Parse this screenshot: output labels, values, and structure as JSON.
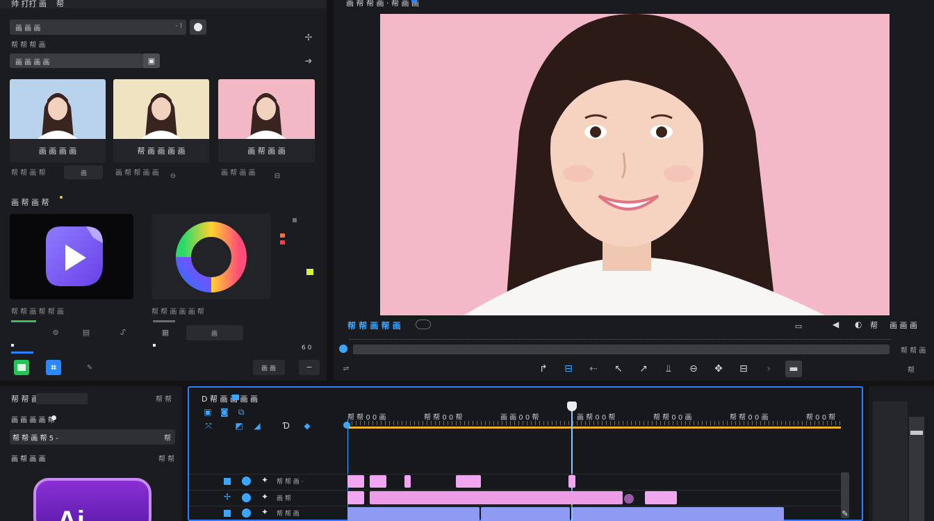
{
  "left_panel": {
    "title": "帅 打打 画    帮",
    "search_value": "画 画 画",
    "search_hint": "- I",
    "section_label": "帮 帮 帮 画",
    "filter_value": "画 画 画 画",
    "presets": [
      {
        "caption": "画 画 画 画",
        "bg": "#b9d3ec"
      },
      {
        "caption": "帮 画 画 画 画",
        "bg": "#efe3c2"
      },
      {
        "caption": "画 帮 画 画",
        "bg": "#f2b8c6"
      }
    ],
    "preset_controls": [
      "帮 帮 画 帮",
      "画 帮 帮 画 画",
      "画 帮 画 画"
    ],
    "preset_ctrl_btn": "画",
    "effects_label": "画 帮 画 帮",
    "effects": [
      {
        "label": "帮 帮 画 帮 帮 画"
      },
      {
        "label": "帮 帮 画 画 画 帮"
      }
    ],
    "effect_btn": "画",
    "mini_btn": "画 画",
    "zoom_ind": "6 0"
  },
  "viewer": {
    "title": "画 帮 帮 画 · 帮 画 画",
    "preview_bg": "#f4b9c8",
    "timecode": "帮 帮 画 帮 画",
    "right_tools": [
      "◀",
      "◐",
      "帮",
      "画 画 画"
    ],
    "transport_icons": [
      "tool-a",
      "tool-b",
      "tool-c",
      "tool-d",
      "tool-e",
      "tool-f",
      "tool-g",
      "tool-h",
      "tool-i",
      "tool-j",
      "tool-k"
    ],
    "side_label": "帮 帮 画",
    "corner_tool": "帮"
  },
  "bottom_left": {
    "row1": "帮 帮 画 画",
    "row1_right": "帮 帮",
    "row2": "画 画 画 画 帮",
    "row3": "帮 帮 画 帮 5 -",
    "row3_right": "帮",
    "row4": "画 帮 画 画",
    "row4_right": "帮 帮",
    "app_logo_text": "Ai"
  },
  "timeline": {
    "title": "D 帮 画 画 画 画",
    "ruler": [
      "帮 帮 0 0 画",
      "帮 帮 0 0 帮",
      "画 画 0 0 帮",
      "画 帮 0 0 帮",
      "帮 帮 0 0 画",
      "帮 帮 0 0 画",
      "帮 0 0 帮"
    ],
    "track_labels": [
      "帮 帮 画 ·",
      "画 帮",
      "帮 帮 画"
    ],
    "playhead_pct": 0.46,
    "accent": "#3aa6ff"
  }
}
